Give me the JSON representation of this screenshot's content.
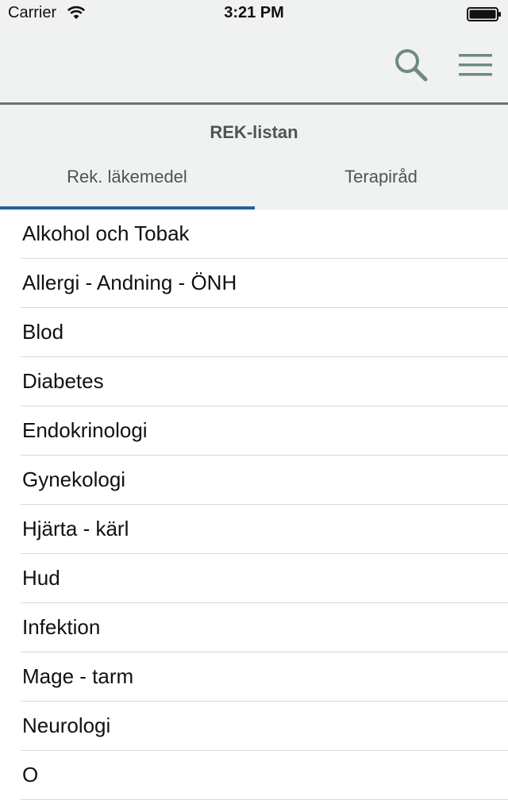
{
  "status_bar": {
    "carrier": "Carrier",
    "time": "3:21 PM",
    "wifi_icon": "wifi-icon",
    "battery_icon": "battery-icon"
  },
  "nav": {
    "search_icon": "search-icon",
    "menu_icon": "hamburger-menu-icon",
    "icon_color": "#6f8a84"
  },
  "header": {
    "title": "REK-listan",
    "tabs": [
      {
        "label": "Rek. läkemedel",
        "selected": true
      },
      {
        "label": "Terapiråd",
        "selected": false
      }
    ],
    "accent_color": "#2a5f9b"
  },
  "list": {
    "items": [
      "Alkohol och Tobak",
      "Allergi - Andning - ÖNH",
      "Blod",
      "Diabetes",
      "Endokrinologi",
      "Gynekologi",
      "Hjärta - kärl",
      "Hud",
      "Infektion",
      "Mage - tarm",
      "Neurologi",
      "O"
    ]
  }
}
